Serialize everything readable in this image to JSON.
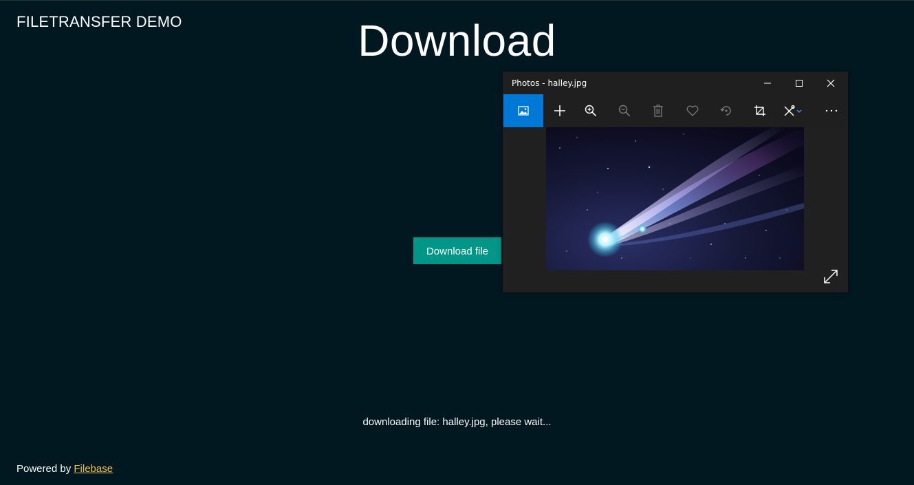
{
  "app": {
    "brand": "FILETRANSFER DEMO",
    "page_title": "Download",
    "download_button": "Download file",
    "status_text": "downloading file: halley.jpg, please wait...",
    "footer": {
      "prefix": "Powered by",
      "link_text": "Filebase"
    }
  },
  "photos_window": {
    "title": "Photos - halley.jpg",
    "toolbar": [
      {
        "icon": "picture-icon",
        "active": true
      },
      {
        "icon": "add-icon"
      },
      {
        "icon": "zoom-in-icon"
      },
      {
        "icon": "zoom-out-icon"
      },
      {
        "icon": "delete-icon"
      },
      {
        "icon": "favorite-heart-icon"
      },
      {
        "icon": "rotate-icon"
      },
      {
        "icon": "crop-icon"
      },
      {
        "icon": "edit-draw-icon"
      },
      {
        "icon": "more-icon"
      }
    ]
  },
  "colors": {
    "page_bg": "#021820",
    "button_bg": "#019688",
    "link": "#f2c14e",
    "window_bg": "#1f1f1f",
    "active_tool": "#0078d7"
  }
}
